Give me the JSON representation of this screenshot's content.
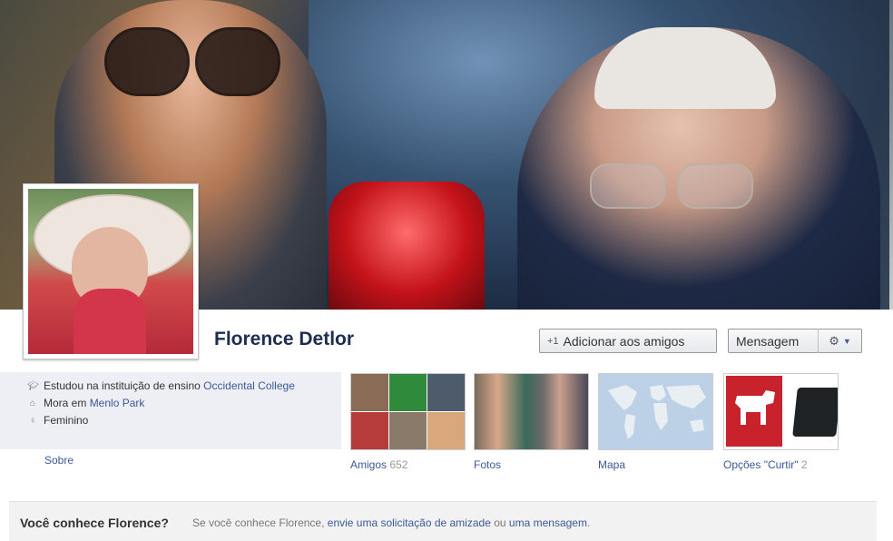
{
  "profile": {
    "name": "Florence Detlor"
  },
  "actions": {
    "add_friend": "Adicionar aos amigos",
    "add_friend_icon": "+1",
    "message": "Mensagem"
  },
  "info": {
    "education_prefix": "Estudou na instituição de ensino",
    "education_link": "Occidental College",
    "lives_prefix": "Mora em",
    "lives_link": "Menlo Park",
    "gender": "Feminino",
    "about": "Sobre"
  },
  "tiles": {
    "friends_label": "Amigos",
    "friends_count": "652",
    "photos_label": "Fotos",
    "map_label": "Mapa",
    "likes_label": "Opções \"Curtir\"",
    "likes_count": "2"
  },
  "know": {
    "title": "Você conhece Florence?",
    "text_prefix": "Se você conhece Florence,",
    "link1": "envie uma solicitação de amizade",
    "middle": "ou",
    "link2": "uma mensagem",
    "suffix": "."
  },
  "colors": {
    "link": "#3b5998",
    "name": "#1f2d52",
    "info_bg": "#edeff4"
  }
}
